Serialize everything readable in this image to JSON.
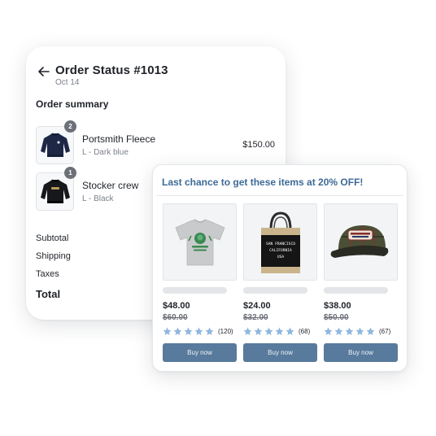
{
  "order": {
    "title": "Order Status #1013",
    "date": "Oct 14",
    "summary_heading": "Order summary",
    "items": [
      {
        "name": "Portsmith Fleece",
        "variant": "L - Dark blue",
        "price": "$150.00",
        "quantity": "2",
        "icon": "navy-sweater-icon"
      },
      {
        "name": "Stocker crew",
        "variant": "L - Black",
        "quantity": "1",
        "icon": "black-sweater-icon"
      }
    ],
    "summary_rows": [
      "Subtotal",
      "Shipping",
      "Taxes"
    ],
    "total_label": "Total"
  },
  "upsell": {
    "header": "Last chance to get these items at 20% OFF!",
    "star_color": "#8fb6de",
    "button_color": "#587a9c",
    "products": [
      {
        "icon": "tshirt-icon",
        "price": "$48.00",
        "old_price": "$60.00",
        "rating": 5,
        "review_count": "(120)",
        "button": "Buy now"
      },
      {
        "icon": "tote-bag-icon",
        "bag_text": [
          "SAN FRANCISCO",
          "CALIFORNIA",
          "USA"
        ],
        "price": "$24.00",
        "old_price": "$32.00",
        "rating": 5,
        "review_count": "(68)",
        "button": "Buy now"
      },
      {
        "icon": "trucker-hat-icon",
        "price": "$38.00",
        "old_price": "$50.00",
        "rating": 5,
        "review_count": "(67)",
        "button": "Buy now"
      }
    ]
  }
}
